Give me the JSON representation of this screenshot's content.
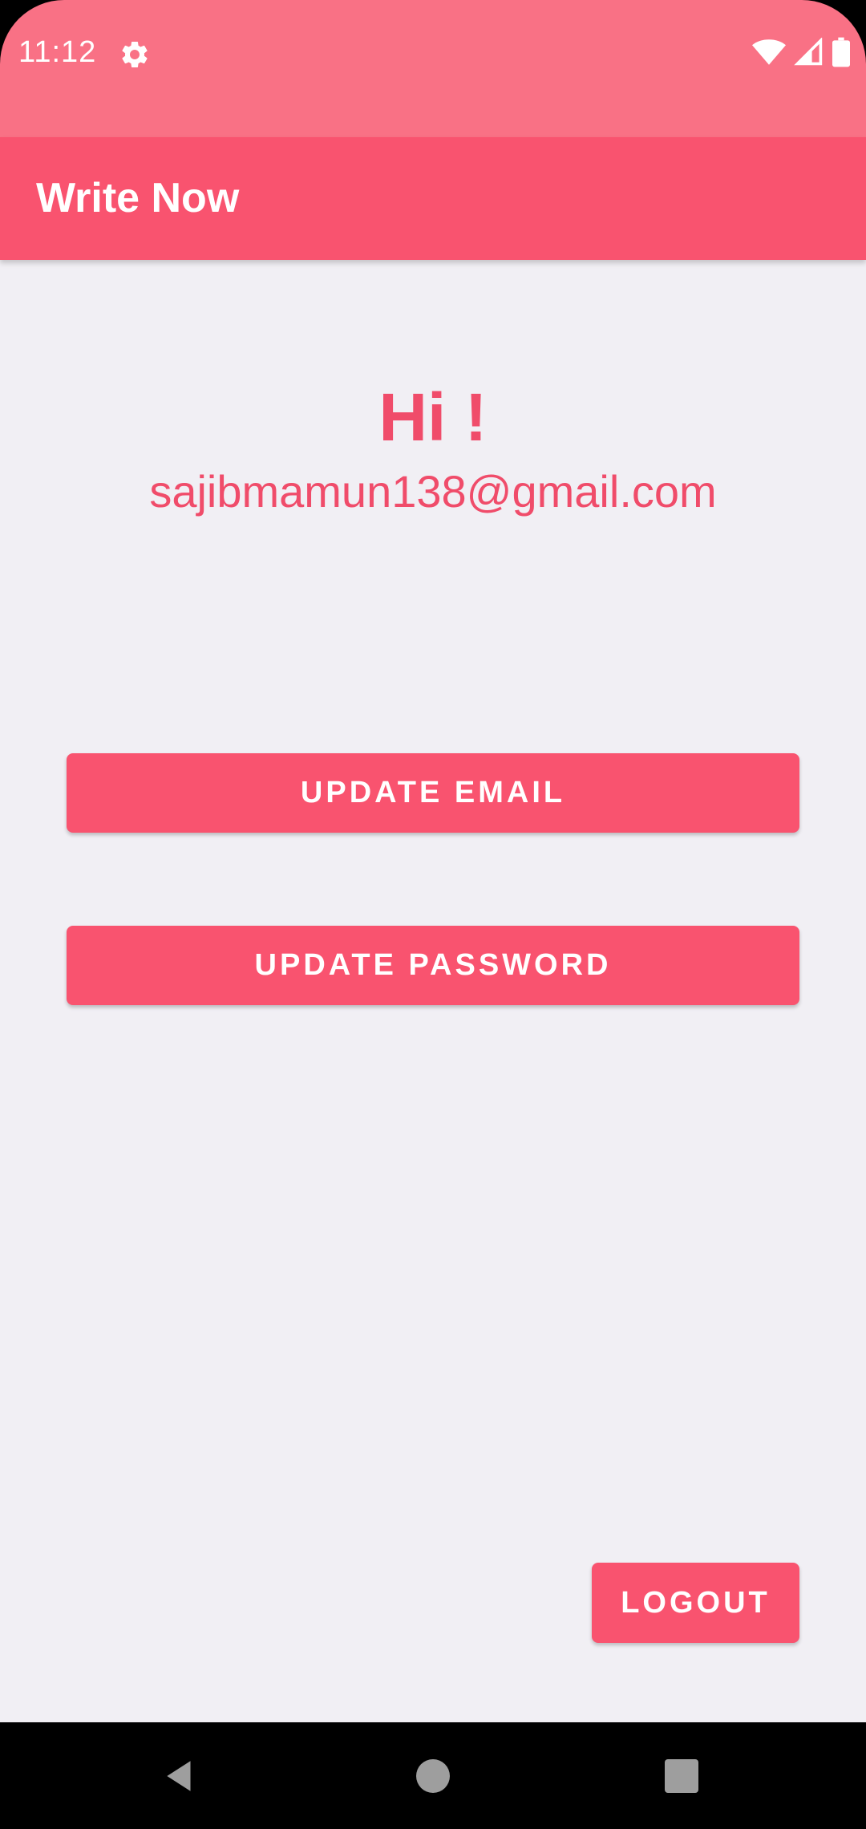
{
  "status_bar": {
    "time": "11:12",
    "icons": [
      "gear-icon",
      "wifi-icon",
      "signal-icon",
      "battery-icon"
    ],
    "background": "#f97185"
  },
  "app_bar": {
    "title": "Write Now",
    "background": "#f9536f"
  },
  "profile": {
    "greeting": "Hi !",
    "email": "sajibmamun138@gmail.com",
    "text_color": "#f04c6a"
  },
  "actions": {
    "update_email_label": "UPDATE EMAIL",
    "update_password_label": "UPDATE PASSWORD",
    "logout_label": "LOGOUT",
    "button_color": "#f9536f"
  },
  "nav_bar": {
    "icons": [
      "back-icon",
      "home-icon",
      "recents-icon"
    ]
  }
}
